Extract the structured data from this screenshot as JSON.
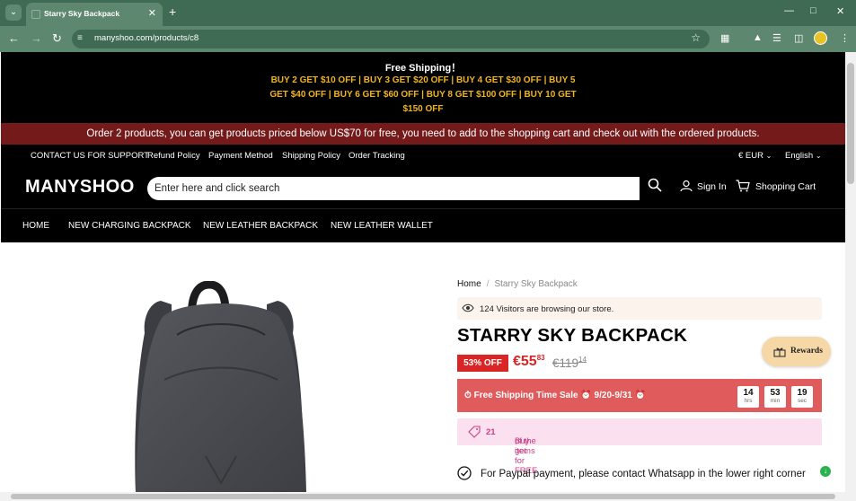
{
  "browser": {
    "tab_title": "Starry Sky Backpack",
    "url": "manyshoo.com/products/c8"
  },
  "promo": {
    "title": "Free Shipping！",
    "line1": "BUY 2 GET $10 OFF | BUY 3 GET $20 OFF | BUY 4 GET $30 OFF | BUY 5",
    "line2": "GET $40 OFF | BUY 6 GET $60 OFF |  BUY 8 GET $100 OFF | BUY 10 GET",
    "line3": "$150 OFF"
  },
  "announcement": "Order 2 products, you can get products priced below US$70 for free, you need to add to the shopping cart and check out with the ordered products.",
  "utility_nav": {
    "support": "CONTACT US FOR SUPPORT",
    "refund": "Refund Policy",
    "payment": "Payment Method",
    "shipping": "Shipping Policy",
    "tracking": "Order Tracking",
    "currency": "€ EUR",
    "language": "English"
  },
  "header": {
    "logo": "MANYSHOO",
    "search_placeholder": "Enter here and click search",
    "signin": "Sign In",
    "cart": "Shopping Cart"
  },
  "main_nav": [
    "HOME",
    "NEW CHARGING BACKPACK",
    "NEW LEATHER BACKPACK",
    "NEW LEATHER WALLET"
  ],
  "product": {
    "breadcrumb_home": "Home",
    "breadcrumb_current": "Starry Sky Backpack",
    "visitors": "124 Visitors are browsing our store.",
    "title": "STARRY SKY BACKPACK",
    "discount": "53% OFF",
    "price_main": "€55",
    "price_cents": "83",
    "old_price_main": "€119",
    "old_price_cents": "14",
    "sale_label": "Free Shipping Time Sale ⏰ 9/20-9/31 ⏰",
    "countdown": [
      {
        "value": "14",
        "unit": "hrs"
      },
      {
        "value": "53",
        "unit": "min"
      },
      {
        "value": "19",
        "unit": "sec"
      }
    ],
    "bogo_prefix": "Buy ",
    "bogo_buy": "2",
    "bogo_mid": ", get ",
    "bogo_get": "1",
    "bogo_suffix": " of the items for FREE",
    "paypal_note": "For Paypal payment, please contact Whatsapp in the lower right corner"
  },
  "rewards": "Rewards",
  "colors": {
    "chrome": "#3f6b55",
    "promo_text": "#f1b51c",
    "announcement_bg": "#741a1a",
    "sale_red": "#d92525",
    "bogo_pink": "#cc3f86"
  }
}
